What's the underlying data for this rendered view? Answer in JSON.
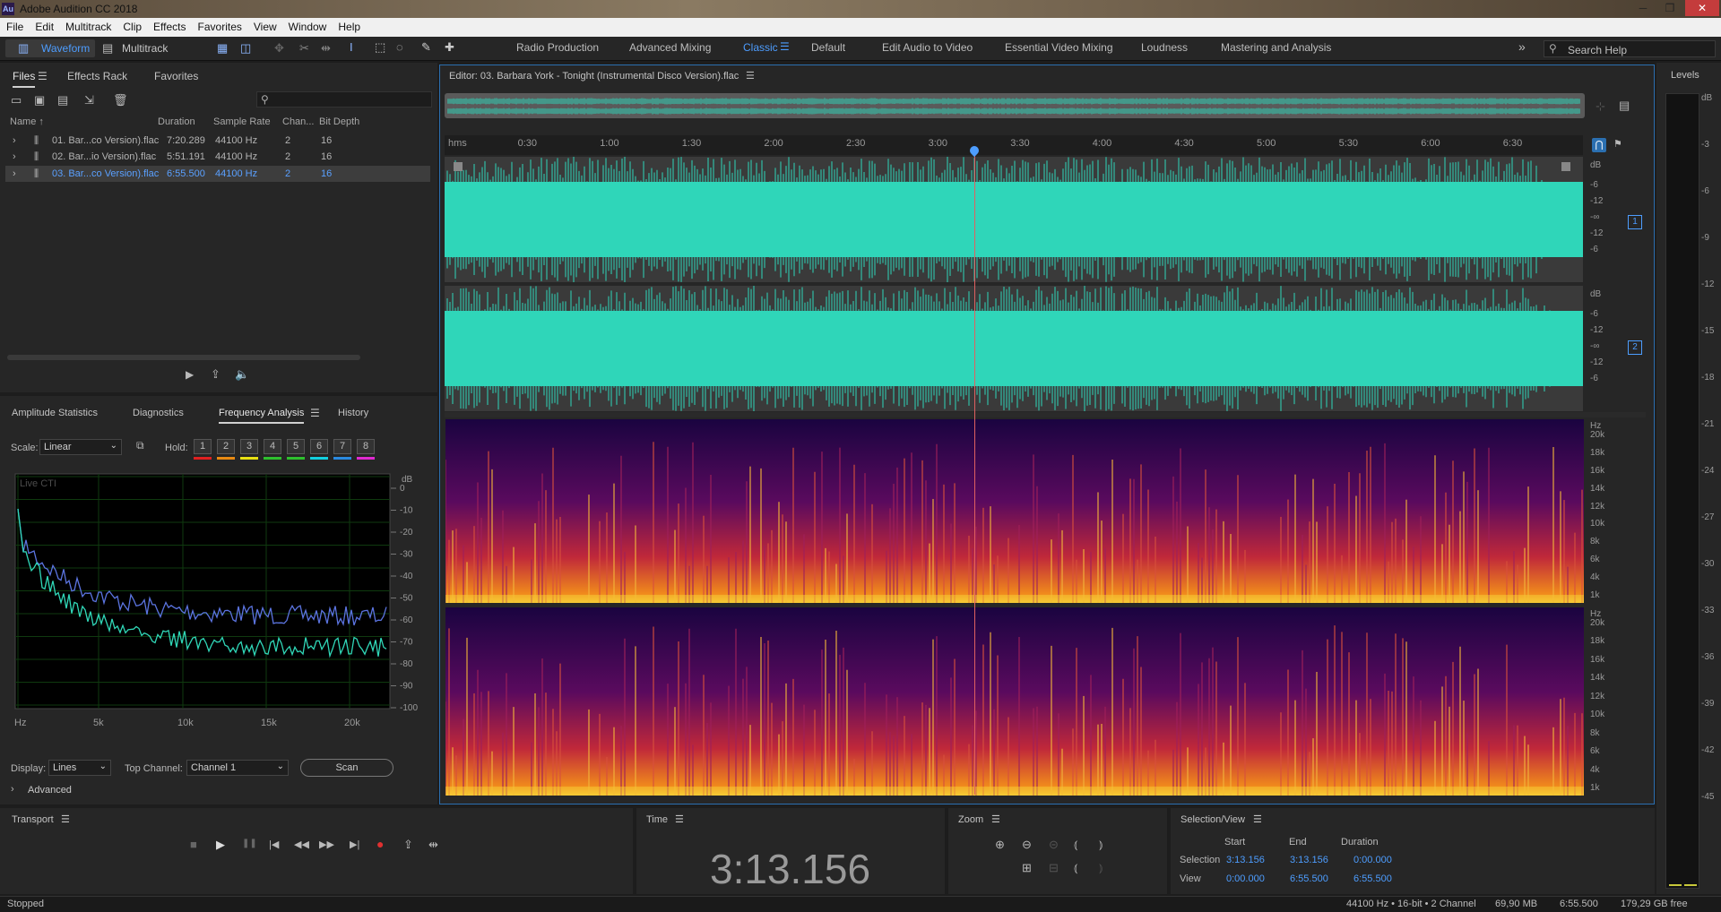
{
  "app": {
    "title": "Adobe Audition CC 2018",
    "icon_text": "Au"
  },
  "window_buttons": [
    "─",
    "❐",
    "✕"
  ],
  "menu": [
    "File",
    "Edit",
    "Multitrack",
    "Clip",
    "Effects",
    "Favorites",
    "View",
    "Window",
    "Help"
  ],
  "toolbar": {
    "waveform_label": "Waveform",
    "multitrack_label": "Multitrack",
    "workspaces": [
      "Radio Production",
      "Advanced Mixing",
      "Classic",
      "Default",
      "Edit Audio to Video",
      "Essential Video Mixing",
      "Loudness",
      "Mastering and Analysis"
    ],
    "active_workspace": "Classic",
    "search_placeholder": "Search Help",
    "overflow": "»"
  },
  "files_panel": {
    "tabs": [
      "Files",
      "Effects Rack",
      "Favorites"
    ],
    "columns": {
      "name": "Name ↑",
      "duration": "Duration",
      "sample_rate": "Sample Rate",
      "channels": "Chan...",
      "bit_depth": "Bit Depth"
    },
    "rows": [
      {
        "name": "01. Bar...co Version).flac",
        "duration": "7:20.289",
        "rate": "44100 Hz",
        "ch": "2",
        "bit": "16"
      },
      {
        "name": "02. Bar...io Version).flac",
        "duration": "5:51.191",
        "rate": "44100 Hz",
        "ch": "2",
        "bit": "16"
      },
      {
        "name": "03. Bar...co Version).flac",
        "duration": "6:55.500",
        "rate": "44100 Hz",
        "ch": "2",
        "bit": "16"
      }
    ],
    "search_glyph": "⚲"
  },
  "analysis_panel": {
    "tabs": [
      "Amplitude Statistics",
      "Diagnostics",
      "Frequency Analysis",
      "History"
    ],
    "active_tab": "Frequency Analysis",
    "scale_label": "Scale:",
    "scale_value": "Linear",
    "hold_label": "Hold:",
    "hold_buttons": [
      "1",
      "2",
      "3",
      "4",
      "5",
      "6",
      "7",
      "8"
    ],
    "hold_colors": [
      "#e02020",
      "#e88a12",
      "#e8e012",
      "#2ec02e",
      "#2ec02e",
      "#12d0e0",
      "#2a8ae0",
      "#e02ad0"
    ],
    "live_label": "Live CTI",
    "db_unit": "dB",
    "db_ticks": [
      "0",
      "-10",
      "-20",
      "-30",
      "-40",
      "-50",
      "-60",
      "-70",
      "-80",
      "-90",
      "-100"
    ],
    "hz_ticks": [
      "Hz",
      "5k",
      "10k",
      "15k",
      "20k"
    ],
    "display_label": "Display:",
    "display_value": "Lines",
    "top_channel_label": "Top Channel:",
    "top_channel_value": "Channel 1",
    "scan_label": "Scan",
    "advanced_label": "Advanced"
  },
  "editor": {
    "title": "Editor: 03. Barbara York - Tonight (Instrumental Disco Version).flac",
    "time_unit": "hms",
    "time_ticks": [
      "0:30",
      "1:00",
      "1:30",
      "2:00",
      "2:30",
      "3:00",
      "3:30",
      "4:00",
      "4:30",
      "5:00",
      "5:30",
      "6:00",
      "6:30"
    ],
    "db_scale": [
      "dB",
      "-6",
      "-12",
      "-∞",
      "-12",
      "-6"
    ],
    "channel_badges": [
      "1",
      "2"
    ],
    "hz_scale": [
      "Hz",
      "20k",
      "18k",
      "16k",
      "14k",
      "12k",
      "10k",
      "8k",
      "6k",
      "4k",
      "1k"
    ],
    "playhead_fraction": 0.465,
    "waveform_color": "#2fd6b9",
    "spectral_colors": [
      "#20064a",
      "#8a1068",
      "#e0401c",
      "#f6c232"
    ]
  },
  "levels": {
    "title": "Levels",
    "ticks": [
      "dB",
      "-3",
      "-6",
      "-9",
      "-12",
      "-15",
      "-18",
      "-21",
      "-24",
      "-27",
      "-30",
      "-33",
      "-36",
      "-39",
      "-42",
      "-45"
    ]
  },
  "transport": {
    "title": "Transport",
    "buttons": [
      "■",
      "▶",
      "❚❚",
      "|◀",
      "◀◀",
      "▶▶",
      "▶|",
      "●",
      "⇪",
      "⇹"
    ]
  },
  "time_panel": {
    "title": "Time",
    "value": "3:13.156"
  },
  "zoom_panel": {
    "title": "Zoom"
  },
  "selection_view": {
    "title": "Selection/View",
    "headers": [
      "Start",
      "End",
      "Duration"
    ],
    "selection_label": "Selection",
    "view_label": "View",
    "selection": [
      "3:13.156",
      "3:13.156",
      "0:00.000"
    ],
    "view": [
      "0:00.000",
      "6:55.500",
      "6:55.500"
    ]
  },
  "status": {
    "state": "Stopped",
    "format": "44100 Hz • 16-bit • 2 Channel",
    "size": "69,90 MB",
    "duration": "6:55.500",
    "free": "179,29 GB free"
  }
}
